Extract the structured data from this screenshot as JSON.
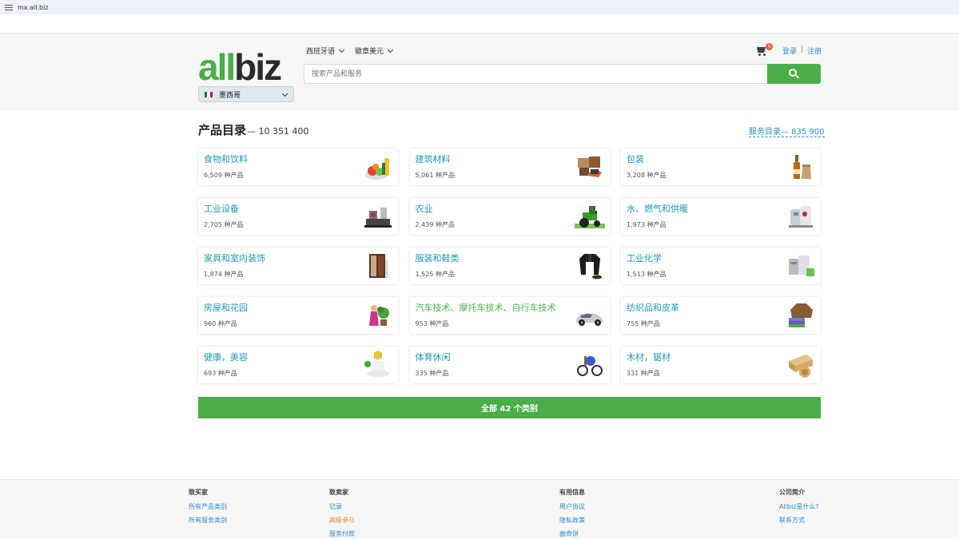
{
  "browser": {
    "url": "mx.all.biz"
  },
  "header": {
    "logo_text": "allbiz",
    "logo_accent_part": "all",
    "logo_dark_part": "biz",
    "country": "墨西哥",
    "language": "西班牙语",
    "currency": "徽章美元",
    "search_placeholder": "搜索产品和服务",
    "cart_count": "0",
    "login": "登录",
    "separator": "|",
    "register": "注册"
  },
  "catalog": {
    "title": "产品目录",
    "count_text": "— 10 351 400",
    "services_link": "服务目录— 835 900",
    "categories": [
      {
        "name": "食物和饮料",
        "count": "6,509 种产品",
        "icon": "food-icon"
      },
      {
        "name": "建筑材料",
        "count": "5,061 种产品",
        "icon": "bricks-icon"
      },
      {
        "name": "包装",
        "count": "3,208 种产品",
        "icon": "bottle-bag-icon"
      },
      {
        "name": "工业设备",
        "count": "2,705 种产品",
        "icon": "machine-icon"
      },
      {
        "name": "农业",
        "count": "2,439 种产品",
        "icon": "tractor-icon"
      },
      {
        "name": "水、燃气和供暖",
        "count": "1,973 种产品",
        "icon": "boiler-icon"
      },
      {
        "name": "家具和室内装饰",
        "count": "1,874 种产品",
        "icon": "wardrobe-icon"
      },
      {
        "name": "服装和鞋类",
        "count": "1,525 种产品",
        "icon": "jacket-icon"
      },
      {
        "name": "工业化学",
        "count": "1,513 种产品",
        "icon": "chemical-icon"
      },
      {
        "name": "房屋和花园",
        "count": "960 种产品",
        "icon": "plant-icon"
      },
      {
        "name": "汽车技术、摩托车技术、自行车技术",
        "count": "953 种产品",
        "icon": "car-icon"
      },
      {
        "name": "纺织品和皮革",
        "count": "755 种产品",
        "icon": "textile-icon"
      },
      {
        "name": "健康，美容",
        "count": "693 种产品",
        "icon": "yoga-icon"
      },
      {
        "name": "体育休闲",
        "count": "335 种产品",
        "icon": "sport-icon"
      },
      {
        "name": "木材，锯材",
        "count": "331 种产品",
        "icon": "wood-icon"
      }
    ],
    "all_button": "全部 42 个类别"
  },
  "footer": {
    "columns": [
      {
        "heading": "致买家",
        "links": [
          "所有产品类别",
          "所有服务类别"
        ]
      },
      {
        "heading": "致卖家",
        "links": [
          "记录",
          "高级参与",
          "服务付款"
        ]
      },
      {
        "heading": "有用信息",
        "links": [
          "用户协议",
          "隐私政策",
          "曲奇饼"
        ]
      },
      {
        "heading": "公司简介",
        "links": [
          "Allbiz是什么?",
          "联系方式"
        ]
      }
    ]
  },
  "colors": {
    "brand_green": "#4aae48",
    "link_blue": "#2a8dbf",
    "category_teal": "#1a9bb6",
    "badge_orange": "#f05a28",
    "premium_orange": "#e08a1e"
  }
}
